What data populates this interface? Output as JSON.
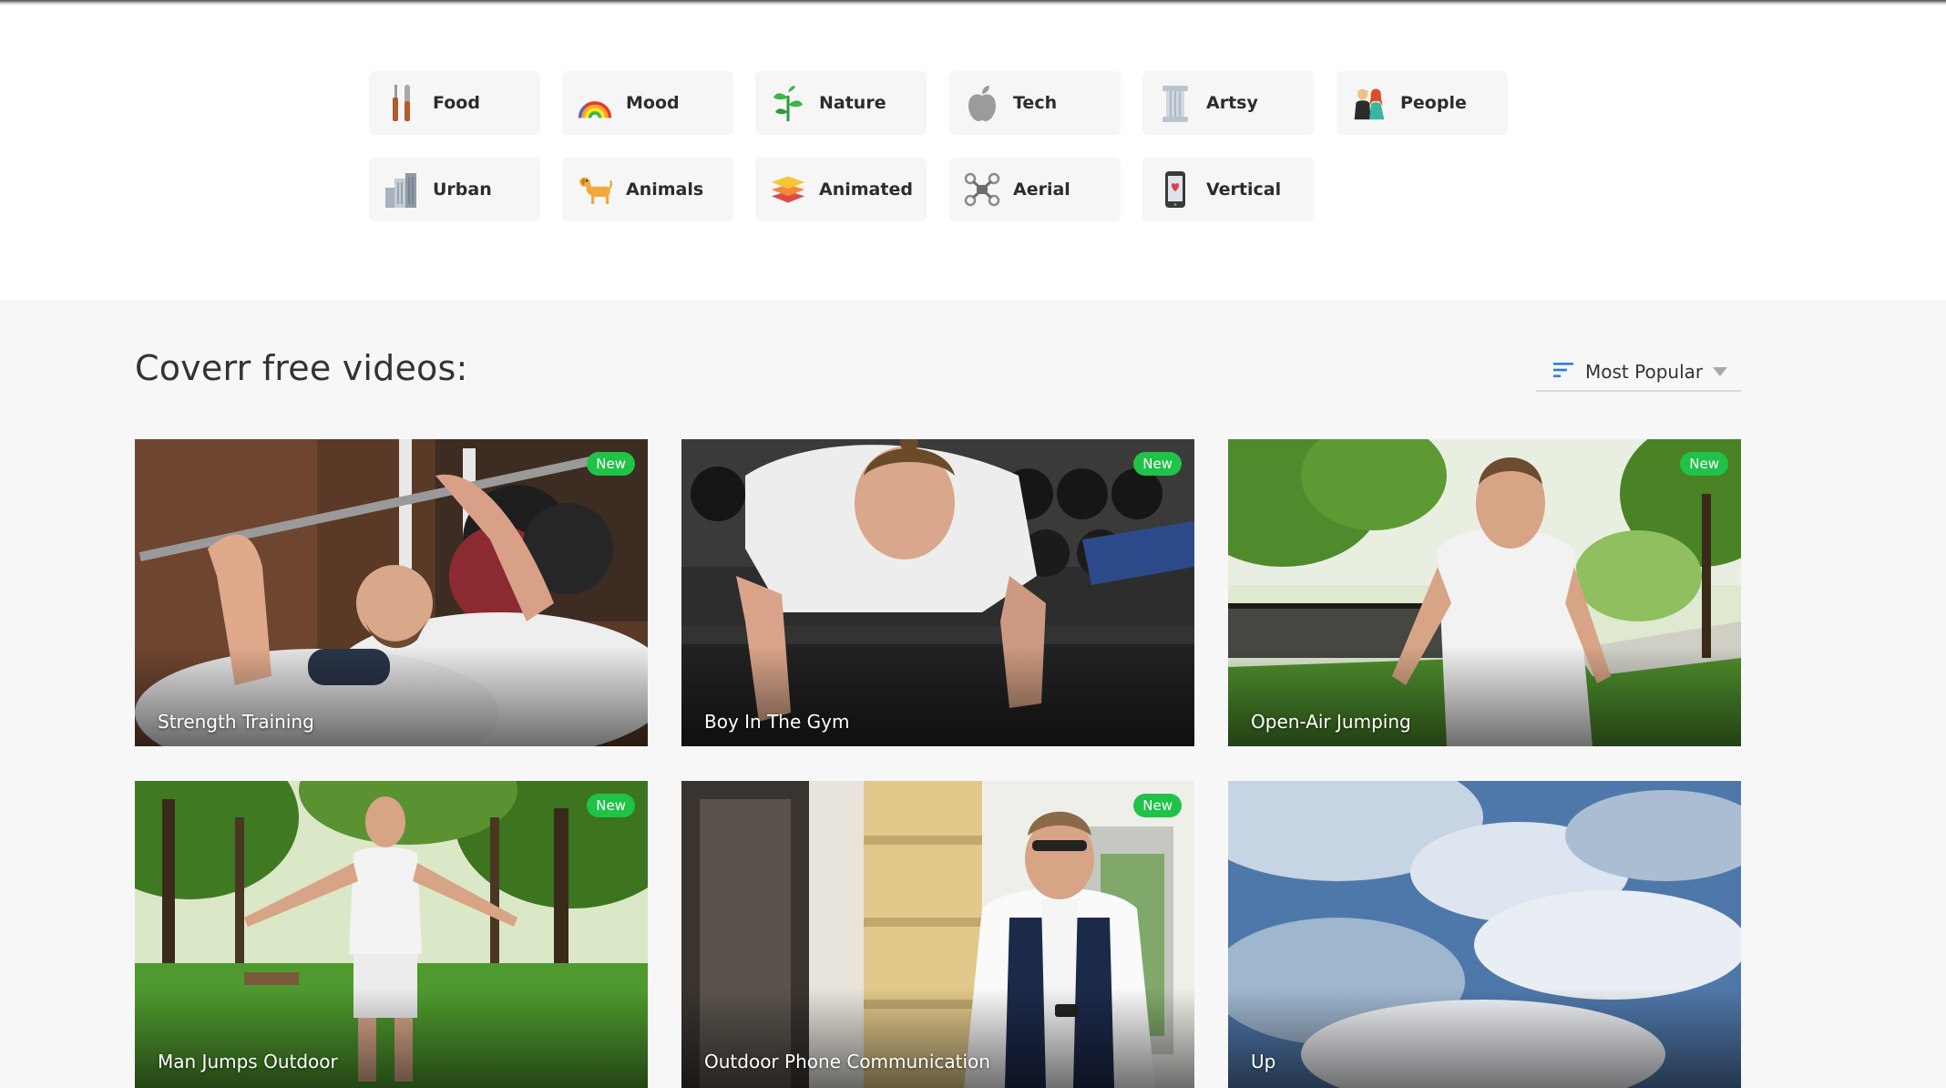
{
  "categories": [
    {
      "label": "Food",
      "icon": "fork-knife-icon"
    },
    {
      "label": "Mood",
      "icon": "rainbow-icon"
    },
    {
      "label": "Nature",
      "icon": "plant-icon"
    },
    {
      "label": "Tech",
      "icon": "apple-icon"
    },
    {
      "label": "Artsy",
      "icon": "column-icon"
    },
    {
      "label": "People",
      "icon": "people-icon"
    },
    {
      "label": "Urban",
      "icon": "buildings-icon"
    },
    {
      "label": "Animals",
      "icon": "dog-icon"
    },
    {
      "label": "Animated",
      "icon": "layers-icon"
    },
    {
      "label": "Aerial",
      "icon": "drone-icon"
    },
    {
      "label": "Vertical",
      "icon": "phone-icon"
    }
  ],
  "main": {
    "heading": "Coverr free videos:",
    "sort_label": "Most Popular"
  },
  "videos": [
    {
      "title": "Strength Training",
      "badge": "New"
    },
    {
      "title": "Boy In The Gym",
      "badge": "New"
    },
    {
      "title": "Open-Air Jumping",
      "badge": "New"
    },
    {
      "title": "Man Jumps Outdoor",
      "badge": "New"
    },
    {
      "title": "Outdoor Phone Communication",
      "badge": "New"
    },
    {
      "title": "Up",
      "badge": ""
    }
  ],
  "colors": {
    "badge_green": "#20c248",
    "sort_icon_blue": "#2f7de1"
  }
}
